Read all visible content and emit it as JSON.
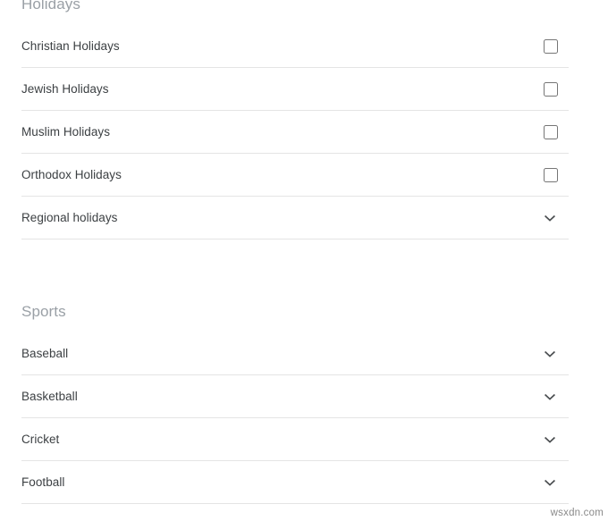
{
  "page": {
    "background_color": "#ffffff",
    "text_color": "#3c4043",
    "heading_color": "#9aa0a6",
    "divider_color": "#e4e4e4",
    "checkbox_border_color": "#6c6f73",
    "chevron_color": "#4a4d50"
  },
  "sections": [
    {
      "id": "holidays",
      "title": "Holidays",
      "rows": [
        {
          "label": "Christian Holidays",
          "control": "checkbox",
          "checked": false
        },
        {
          "label": "Jewish Holidays",
          "control": "checkbox",
          "checked": false
        },
        {
          "label": "Muslim Holidays",
          "control": "checkbox",
          "checked": false
        },
        {
          "label": "Orthodox Holidays",
          "control": "checkbox",
          "checked": false
        },
        {
          "label": "Regional holidays",
          "control": "chevron-down-icon",
          "checked": false
        }
      ]
    },
    {
      "id": "sports",
      "title": "Sports",
      "rows": [
        {
          "label": "Baseball",
          "control": "chevron-down-icon",
          "checked": false
        },
        {
          "label": "Basketball",
          "control": "chevron-down-icon",
          "checked": false
        },
        {
          "label": "Cricket",
          "control": "chevron-down-icon",
          "checked": false
        },
        {
          "label": "Football",
          "control": "chevron-down-icon",
          "checked": false
        }
      ]
    }
  ],
  "watermark": {
    "text": "wsxdn.com"
  }
}
